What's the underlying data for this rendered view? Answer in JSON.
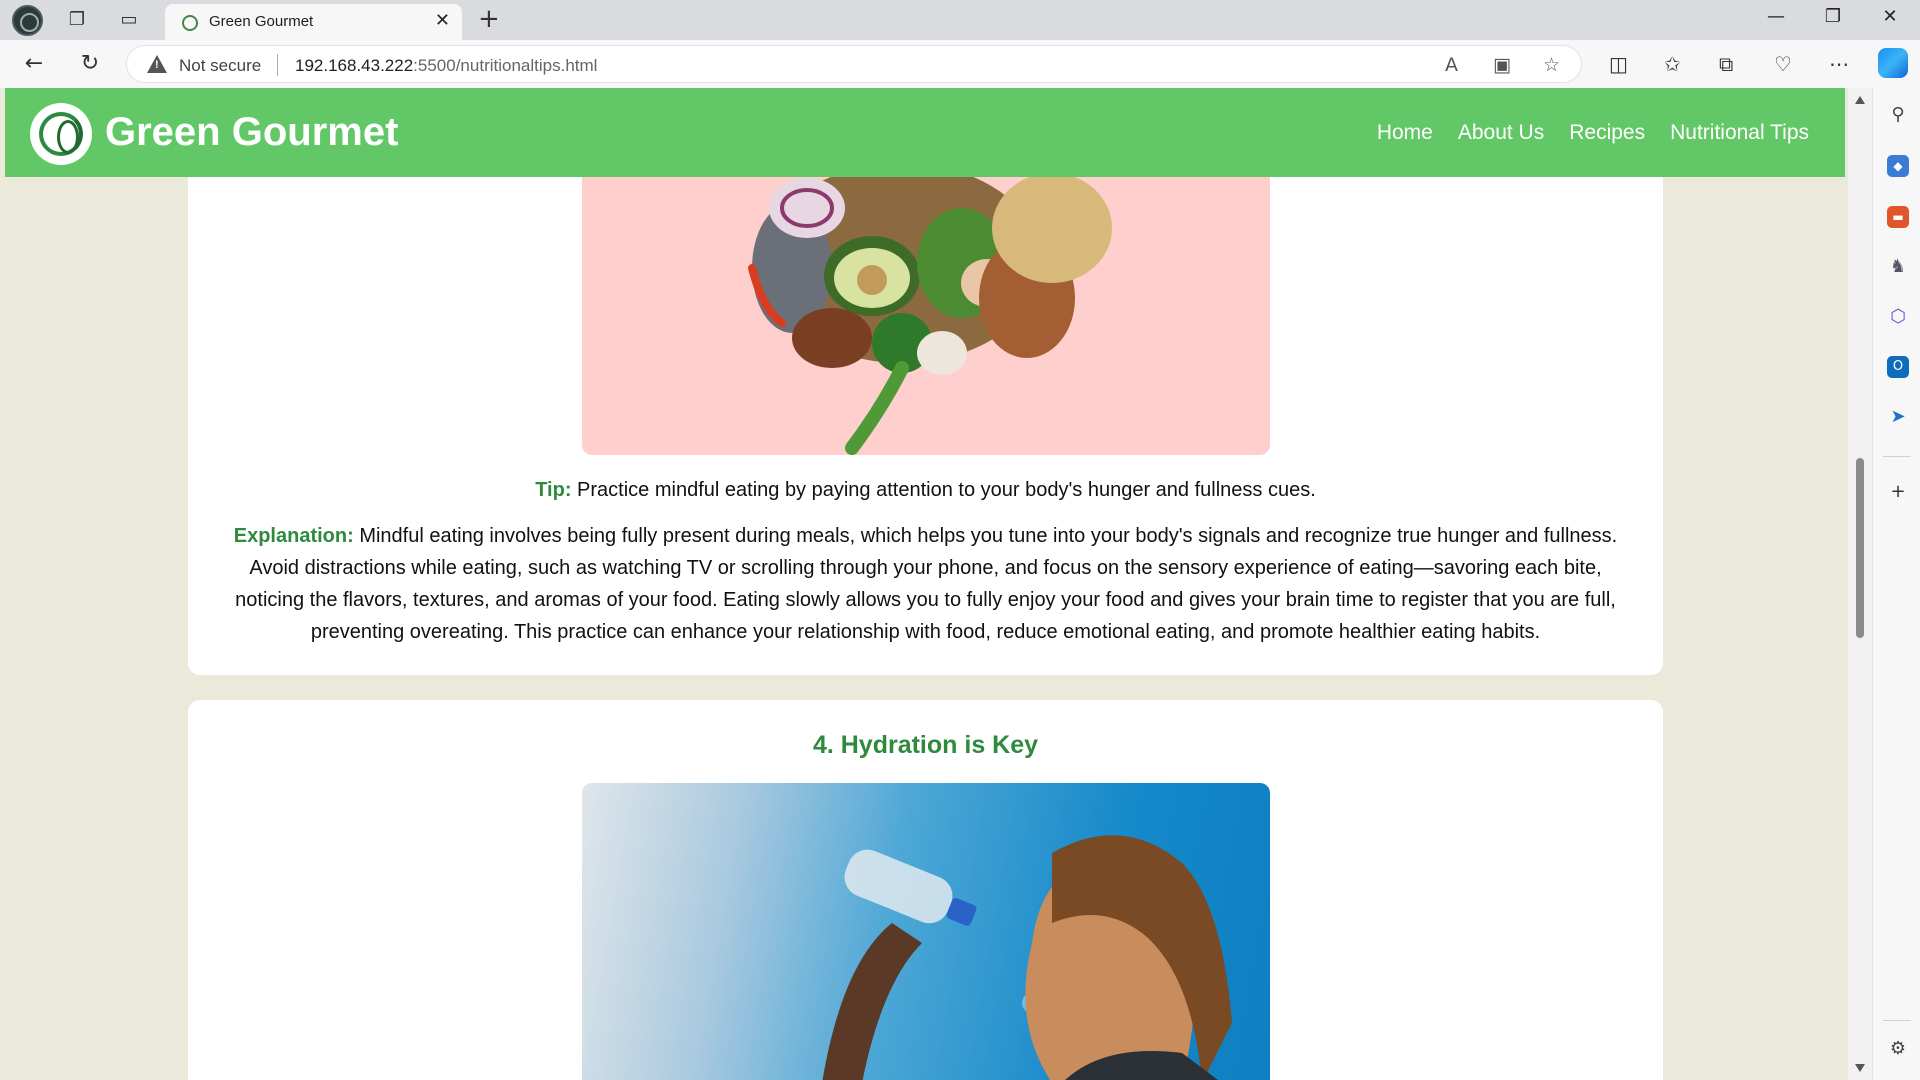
{
  "browser": {
    "tab_title": "Green Gourmet",
    "security_label": "Not secure",
    "url_host": "192.168.43.222",
    "url_rest": ":5500/nutritionaltips.html"
  },
  "site": {
    "title": "Green Gourmet",
    "nav": [
      "Home",
      "About Us",
      "Recipes",
      "Nutritional Tips"
    ],
    "accent_color": "#62c767",
    "heading_color": "#2e8a3c"
  },
  "tip3": {
    "tip_label": "Tip:",
    "tip_text": " Practice mindful eating by paying attention to your body's hunger and fullness cues.",
    "explanation_label": "Explanation:",
    "explanation_text": " Mindful eating involves being fully present during meals, which helps you tune into your body's signals and recognize true hunger and fullness. Avoid distractions while eating, such as watching TV or scrolling through your phone, and focus on the sensory experience of eating—savoring each bite, noticing the flavors, textures, and aromas of your food. Eating slowly allows you to fully enjoy your food and gives your brain time to register that you are full, preventing overeating. This practice can enhance your relationship with food, reduce emotional eating, and promote healthier eating habits."
  },
  "tip4": {
    "heading": "4. Hydration is Key"
  }
}
